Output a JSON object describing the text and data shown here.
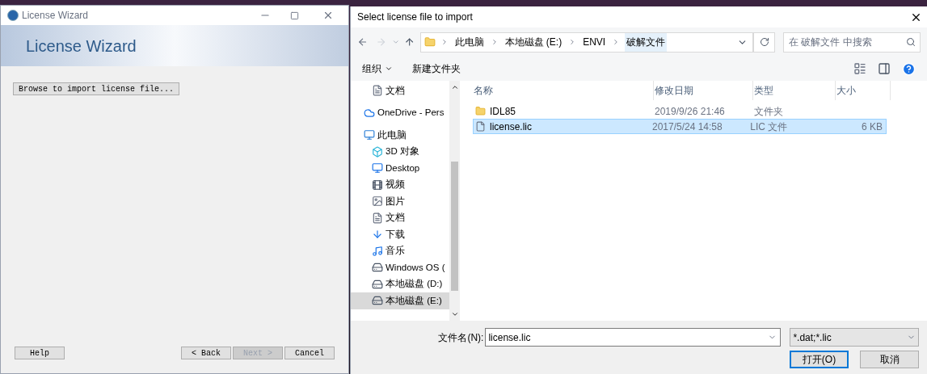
{
  "wizard": {
    "title": "License Wizard",
    "header": "License Wizard",
    "browse_button": "Browse to import license file...",
    "buttons": [
      {
        "label": "Help",
        "disabled": false
      },
      {
        "label": "< Back",
        "disabled": false
      },
      {
        "label": "Next >",
        "disabled": true
      },
      {
        "label": "Cancel",
        "disabled": false
      }
    ]
  },
  "dialog": {
    "title": "Select license file to import",
    "breadcrumb": [
      {
        "label": "此电脑",
        "selected": false
      },
      {
        "label": "本地磁盘 (E:)",
        "selected": false
      },
      {
        "label": "ENVI",
        "selected": false
      },
      {
        "label": "破解文件",
        "selected": true
      }
    ],
    "search": {
      "placeholder": "在 破解文件 中搜索"
    },
    "toolbar": [
      "组织",
      "新建文件夹"
    ],
    "sidebar": {
      "items": [
        {
          "label": "文档",
          "selected": false
        },
        {
          "label": "OneDrive - Pers",
          "selected": false
        },
        {
          "label": "此电脑",
          "selected": false
        },
        {
          "label": "3D 对象",
          "selected": false
        },
        {
          "label": "Desktop",
          "selected": false
        },
        {
          "label": "视频",
          "selected": false
        },
        {
          "label": "图片",
          "selected": false
        },
        {
          "label": "文档",
          "selected": false
        },
        {
          "label": "下载",
          "selected": false
        },
        {
          "label": "音乐",
          "selected": false
        },
        {
          "label": "Windows OS (",
          "selected": false
        },
        {
          "label": "本地磁盘 (D:)",
          "selected": false
        },
        {
          "label": "本地磁盘 (E:)",
          "selected": true
        }
      ]
    },
    "table": {
      "columns": [
        "名称",
        "修改日期",
        "类型",
        "大小"
      ],
      "rows": [
        {
          "kind": "folder",
          "name": "IDL85",
          "date": "2019/9/26 21:46",
          "type": "文件夹",
          "size": "",
          "selected": false
        },
        {
          "kind": "file",
          "name": "license.lic",
          "date": "2017/5/24 14:58",
          "type": "LIC 文件",
          "size": "6 KB",
          "selected": true
        }
      ]
    },
    "filename": {
      "label": "文件名(N):",
      "value": "license.lic"
    },
    "filter": "*.dat;*.lic",
    "buttons": [
      {
        "label": "打开(O)",
        "default": true
      },
      {
        "label": "取消",
        "default": false
      }
    ]
  }
}
